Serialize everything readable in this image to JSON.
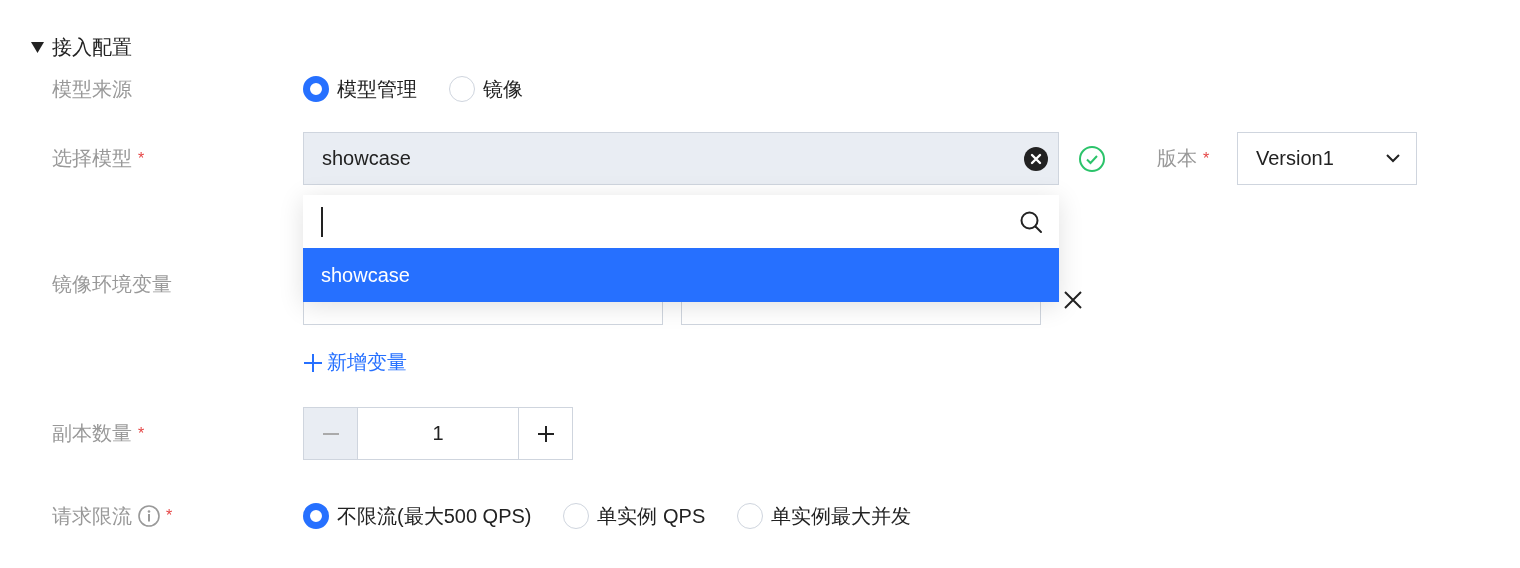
{
  "required_mark": "*",
  "section": {
    "title": "接入配置",
    "expanded": true
  },
  "model_source": {
    "label": "模型来源",
    "options": [
      {
        "label": "模型管理",
        "selected": true
      },
      {
        "label": "镜像",
        "selected": false
      }
    ]
  },
  "model": {
    "label": "选择模型",
    "required": true,
    "value": "showcase",
    "valid": true,
    "dropdown": {
      "open": true,
      "options": [
        {
          "label": "showcase",
          "selected": true
        }
      ]
    }
  },
  "version": {
    "label": "版本",
    "required": true,
    "value": "Version1"
  },
  "env": {
    "label": "镜像环境变量",
    "add_label": "新增变量"
  },
  "replicas": {
    "label": "副本数量",
    "required": true,
    "value": "1",
    "decrement_disabled": true
  },
  "rate_limit": {
    "label": "请求限流",
    "required": true,
    "info": true,
    "options": [
      {
        "label": "不限流(最大500 QPS)",
        "selected": true
      },
      {
        "label": "单实例 QPS",
        "selected": false
      },
      {
        "label": "单实例最大并发",
        "selected": false
      }
    ]
  }
}
